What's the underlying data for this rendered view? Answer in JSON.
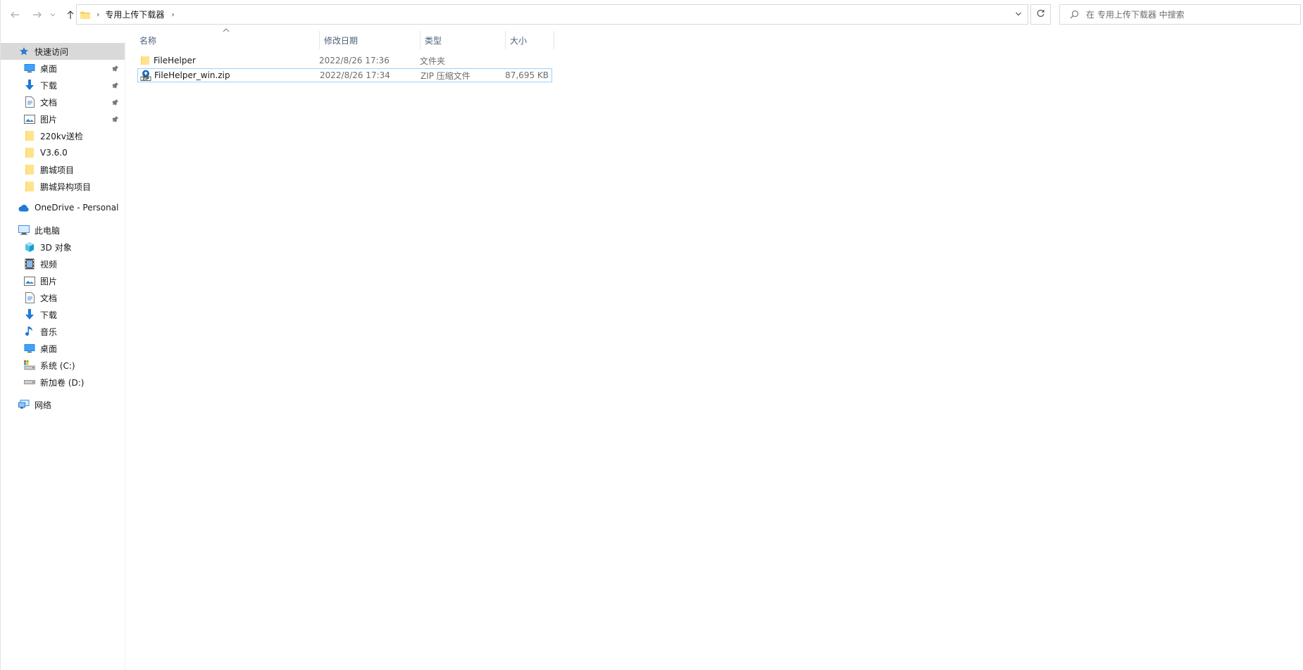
{
  "window": {
    "accent_color": "#0078d7",
    "selection_border_color": "#99d1ff",
    "sidebar_active_color": "#d9d9d9"
  },
  "toolbar": {
    "back_icon": "arrow-left-icon",
    "forward_icon": "arrow-right-icon",
    "recent_icon": "chevron-down-icon",
    "up_icon": "arrow-up-icon"
  },
  "address": {
    "separator": "›",
    "crumbs": [
      "专用上传下载器"
    ],
    "trailing_separator": "›"
  },
  "search": {
    "placeholder": "在 专用上传下载器 中搜索"
  },
  "sidebar": {
    "quick_access": {
      "label": "快速访问",
      "items": [
        {
          "label": "桌面",
          "icon": "desktop-icon",
          "pinned": true
        },
        {
          "label": "下载",
          "icon": "download-icon",
          "pinned": true
        },
        {
          "label": "文档",
          "icon": "document-icon",
          "pinned": true
        },
        {
          "label": "图片",
          "icon": "pictures-icon",
          "pinned": true
        },
        {
          "label": "220kv送检",
          "icon": "folder-icon",
          "pinned": false
        },
        {
          "label": "V3.6.0",
          "icon": "folder-icon",
          "pinned": false
        },
        {
          "label": "鹏城项目",
          "icon": "folder-icon",
          "pinned": false
        },
        {
          "label": "鹏城异构项目",
          "icon": "folder-icon",
          "pinned": false
        }
      ]
    },
    "onedrive": {
      "label": "OneDrive - Personal"
    },
    "this_pc": {
      "label": "此电脑",
      "items": [
        {
          "label": "3D 对象",
          "icon": "3d-objects-icon"
        },
        {
          "label": "视频",
          "icon": "videos-icon"
        },
        {
          "label": "图片",
          "icon": "pictures-icon"
        },
        {
          "label": "文档",
          "icon": "document-icon"
        },
        {
          "label": "下载",
          "icon": "download-icon"
        },
        {
          "label": "音乐",
          "icon": "music-icon"
        },
        {
          "label": "桌面",
          "icon": "desktop-icon"
        },
        {
          "label": "系统 (C:)",
          "icon": "system-drive-icon"
        },
        {
          "label": "新加卷 (D:)",
          "icon": "drive-icon"
        }
      ]
    },
    "network": {
      "label": "网络"
    }
  },
  "columns": {
    "name": "名称",
    "date": "修改日期",
    "type": "类型",
    "size": "大小"
  },
  "files": [
    {
      "name": "FileHelper",
      "date": "2022/8/26 17:36",
      "type": "文件夹",
      "size": "",
      "icon": "folder-icon",
      "selected": false
    },
    {
      "name": "FileHelper_win.zip",
      "date": "2022/8/26 17:34",
      "type": "ZIP 压缩文件",
      "size": "87,695 KB",
      "icon": "zip-archive-icon",
      "selected": true
    }
  ]
}
